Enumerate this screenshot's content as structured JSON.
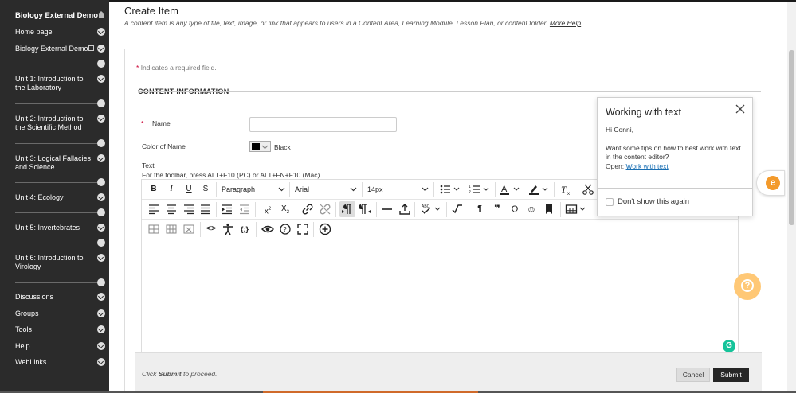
{
  "sidebar": {
    "course_title": "Biology External Demo",
    "items": [
      {
        "label": "Home page"
      },
      {
        "label": "Biology External Demo"
      },
      {
        "label": "Unit 1: Introduction to the Laboratory"
      },
      {
        "label": "Unit 2: Introduction to the Scientific Method"
      },
      {
        "label": "Unit 3: Logical Fallacies and Science"
      },
      {
        "label": "Unit 4: Ecology"
      },
      {
        "label": "Unit 5: Invertebrates"
      },
      {
        "label": "Unit 6: Introduction to Virology"
      },
      {
        "label": "Discussions"
      },
      {
        "label": "Groups"
      },
      {
        "label": "Tools"
      },
      {
        "label": "Help"
      },
      {
        "label": "WebLinks"
      }
    ]
  },
  "page": {
    "title": "Create Item",
    "description": "A content item is any type of file, text, image, or link that appears to users in a Content Area, Learning Module, Lesson Plan, or content folder.",
    "more_help": "More Help",
    "required_note": "Indicates a required field.",
    "required_star": "*",
    "section_title": "CONTENT INFORMATION"
  },
  "form": {
    "name_label": "Name",
    "name_value": "",
    "color_label": "Color of Name",
    "color_value": "Black",
    "text_label": "Text",
    "toolbar_hint": "For the toolbar, press ALT+F10 (PC) or ALT+FN+F10 (Mac)."
  },
  "editor": {
    "paragraph_select": "Paragraph",
    "font_select": "Arial",
    "size_select": "14px"
  },
  "popover": {
    "title": "Working with text",
    "greeting": "Hi Conni,",
    "body": "Want some tips on how to best work with text in the content editor?",
    "open_prefix": "Open:",
    "link": "Work with text",
    "checkbox_label": "Don't show this again"
  },
  "footer": {
    "hint_prefix": "Click",
    "hint_strong": "Submit",
    "hint_suffix": "to proceed.",
    "cancel_label": "Cancel",
    "submit_label": "Submit"
  },
  "colors": {
    "sidebar_bg": "#2b2b2b",
    "submit_bg": "#262626",
    "help_bubble": "#ffc876",
    "required_star": "#cc0033",
    "link": "#1a6fb3"
  }
}
